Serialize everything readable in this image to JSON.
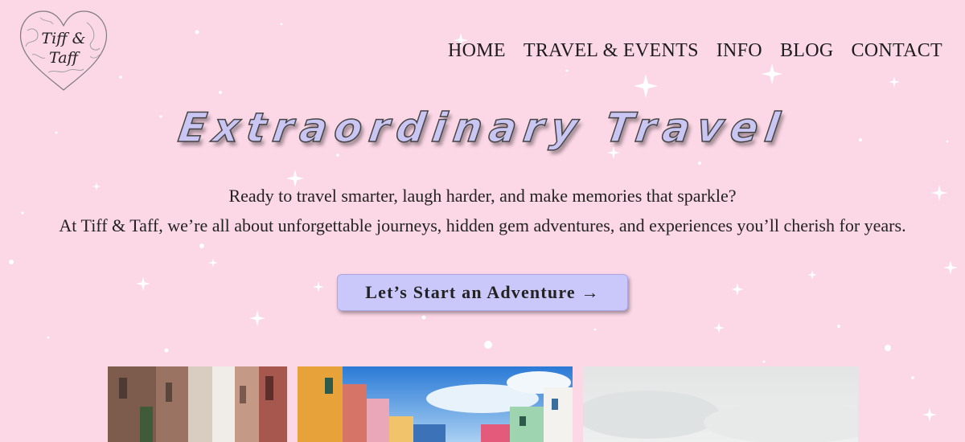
{
  "logo": {
    "line1": "Tiff &",
    "line2": "Taff"
  },
  "nav": {
    "items": [
      {
        "label": "Home"
      },
      {
        "label": "Travel & Events"
      },
      {
        "label": "Info"
      },
      {
        "label": "Blog"
      },
      {
        "label": "Contact"
      }
    ]
  },
  "hero": {
    "title": "Extraordinary Travel",
    "line1": "Ready to travel smarter, laugh harder, and make memories that sparkle?",
    "line2": "At Tiff & Taff, we’re all about unforgettable journeys, hidden gem adventures, and experiences you’ll cherish for years.",
    "cta_label": "Let’s Start an Adventure →"
  },
  "colors": {
    "background": "#fcd7e6",
    "title_fill": "#c9c6f4",
    "button_bg": "#cac8fb"
  }
}
